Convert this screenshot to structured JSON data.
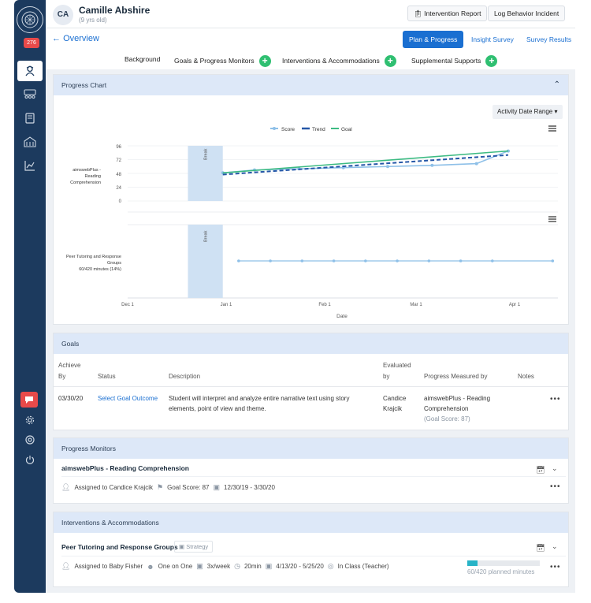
{
  "sidebar": {
    "badge": "276",
    "icons": [
      "logo-icon",
      "student-icon",
      "group-icon",
      "book-icon",
      "school-icon",
      "chart-icon",
      "chat-icon",
      "gear-icon",
      "help-icon",
      "power-icon"
    ]
  },
  "student": {
    "initials": "CA",
    "name": "Camille Abshire",
    "age": "(9 yrs old)"
  },
  "header": {
    "intervention_report": "Intervention Report",
    "log_incident": "Log Behavior Incident"
  },
  "overview": {
    "back_label": "Overview"
  },
  "tabs": [
    "Plan & Progress",
    "Insight Survey",
    "Survey Results"
  ],
  "subnav": {
    "background": "Background",
    "goals": "Goals & Progress Monitors",
    "interventions": "Interventions & Accommodations",
    "supports": "Supplemental Supports"
  },
  "progress_chart": {
    "title": "Progress Chart",
    "date_range": "Activity Date Range",
    "legend": [
      "Score",
      "Trend",
      "Goal"
    ],
    "break_label": "Break",
    "y_ticks": [
      "96",
      "72",
      "48",
      "24",
      "0"
    ],
    "series1_label": [
      "aimswebPlus -",
      "Reading",
      "Comprehension"
    ],
    "series2_label": [
      "Peer Tutoring and Response",
      "Groups",
      "60/420 minutes (14%)"
    ],
    "x_ticks": [
      "Dec 1",
      "Jan 1",
      "Feb 1",
      "Mar 1",
      "Apr 1"
    ],
    "xlabel": "Date"
  },
  "chart_data": {
    "type": "line",
    "title": "",
    "xlabel": "Date",
    "ylabel": "",
    "ylim": [
      0,
      96
    ],
    "xlim": [
      "2019-11-25",
      "2020-04-15"
    ],
    "break_range": [
      "2019-12-20",
      "2019-12-31"
    ],
    "series": [
      {
        "name": "Score",
        "x": [
          "2019-12-31",
          "2020-01-10",
          "2020-01-24",
          "2020-02-07",
          "2020-02-21",
          "2020-03-06",
          "2020-03-20",
          "2020-03-30"
        ],
        "values": [
          49,
          54,
          56,
          58,
          60,
          62,
          65,
          87
        ]
      },
      {
        "name": "Trend",
        "x": [
          "2019-12-31",
          "2020-03-30"
        ],
        "values": [
          46,
          80
        ]
      },
      {
        "name": "Goal",
        "x": [
          "2019-12-31",
          "2020-03-30"
        ],
        "values": [
          49,
          87
        ]
      }
    ],
    "minutes_series": {
      "x": [
        "2020-01-05",
        "2020-01-15",
        "2020-01-25",
        "2020-02-04",
        "2020-02-14",
        "2020-02-24",
        "2020-03-05",
        "2020-03-15",
        "2020-03-25",
        "2020-04-13"
      ],
      "values": [
        1,
        1,
        1,
        1,
        1,
        1,
        1,
        1,
        1,
        1
      ]
    }
  },
  "goals": {
    "title": "Goals",
    "headers": {
      "achieve_by": [
        "Achieve",
        "By"
      ],
      "status": "Status",
      "description": "Description",
      "evaluated_by": [
        "Evaluated",
        "by"
      ],
      "measured_by": "Progress Measured by",
      "notes": "Notes"
    },
    "row": {
      "date": "03/30/20",
      "status": "Select Goal Outcome",
      "description": [
        "Student will interpret and analyze entire narrative text using story",
        "elements, point of view and theme."
      ],
      "evaluator": [
        "Candice",
        "Krajcik"
      ],
      "measure": [
        "aimswebPlus - Reading",
        "Comprehension"
      ],
      "goal_score": "(Goal Score: 87)"
    }
  },
  "monitors": {
    "title": "Progress Monitors",
    "item": "aimswebPlus - Reading Comprehension",
    "assigned": "Assigned to Candice Krajcik",
    "goal_score": "Goal Score: 87",
    "dates": "12/30/19 - 3/30/20"
  },
  "interventions": {
    "title": "Interventions & Accommodations",
    "item": "Peer Tutoring and Response Groups",
    "tag": "Strategy",
    "assigned": "Assigned to Baby Fisher",
    "format": "One on One",
    "frequency": "3x/week",
    "duration": "20min",
    "dates": "4/13/20 - 5/25/20",
    "setting": "In Class (Teacher)",
    "progress": 0.14,
    "planned": "60/420 planned minutes"
  },
  "colors": {
    "sidebar": "#1c3a5e",
    "primary": "#1a6fd1",
    "green": "#2fbf71",
    "score": "#8ec0e8",
    "trend": "#2557a7",
    "goal": "#3dbb83"
  }
}
